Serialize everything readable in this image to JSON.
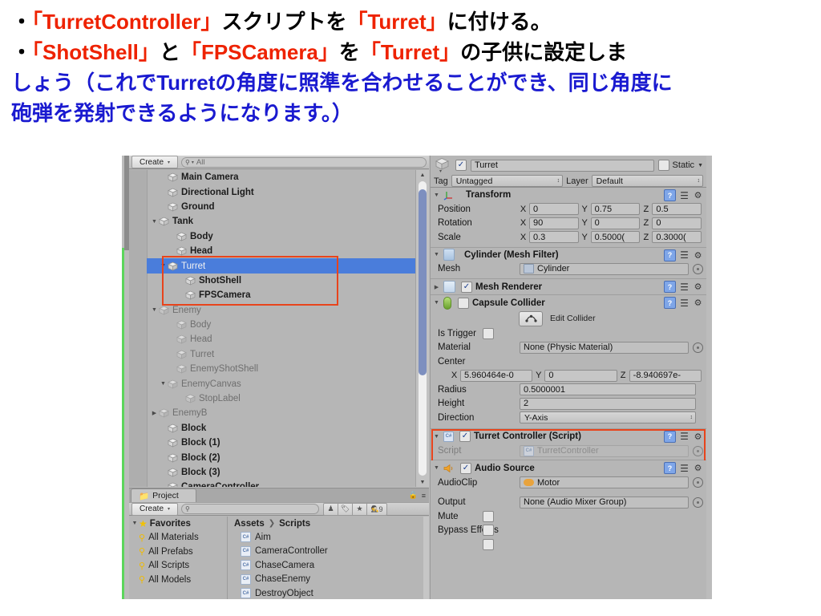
{
  "slide": {
    "line1": [
      {
        "t": "・",
        "c": "blk"
      },
      {
        "t": "「TurretController」",
        "c": "red"
      },
      {
        "t": "スクリプトを",
        "c": "blk"
      },
      {
        "t": "「Turret」",
        "c": "red"
      },
      {
        "t": "に付ける。",
        "c": "blk"
      }
    ],
    "line2": [
      {
        "t": "・",
        "c": "blk"
      },
      {
        "t": "「ShotShell」",
        "c": "red"
      },
      {
        "t": "と",
        "c": "blk"
      },
      {
        "t": "「FPSCamera」",
        "c": "red"
      },
      {
        "t": "を",
        "c": "blk"
      },
      {
        "t": "「Turret」",
        "c": "red"
      },
      {
        "t": "の子供に設定しま",
        "c": "blk"
      }
    ],
    "line3": [
      {
        "t": "しょう（これでTurretの角度に照準を合わせることができ、同じ角度に",
        "c": "blue"
      }
    ],
    "line4": [
      {
        "t": "砲弾を発射できるようになります。）",
        "c": "blue"
      }
    ]
  },
  "colors": {
    "accent_red": "#ee2200",
    "accent_blue": "#1a1ad0",
    "highlight_box": "#e8441c",
    "selection_blue": "#4a7ddb",
    "panel_gray": "#b6b6b6",
    "green_edge": "#5cd65c"
  },
  "hierarchy": {
    "create_label": "Create",
    "create_arrow": "▾",
    "search_placeholder": "All",
    "search_icon": "search-icon",
    "nodes": [
      {
        "label": "Main Camera",
        "indent": 1,
        "fold": "",
        "style": "bold",
        "selected": false
      },
      {
        "label": "Directional Light",
        "indent": 1,
        "fold": "",
        "style": "bold",
        "selected": false
      },
      {
        "label": "Ground",
        "indent": 1,
        "fold": "",
        "style": "bold",
        "selected": false
      },
      {
        "label": "Tank",
        "indent": 0,
        "fold": "▼",
        "style": "bold",
        "selected": false
      },
      {
        "label": "Body",
        "indent": 2,
        "fold": "",
        "style": "bold",
        "selected": false
      },
      {
        "label": "Head",
        "indent": 2,
        "fold": "",
        "style": "bold",
        "selected": false
      },
      {
        "label": "Turret",
        "indent": 1,
        "fold": "▼",
        "style": "sel",
        "selected": true
      },
      {
        "label": "ShotShell",
        "indent": 3,
        "fold": "",
        "style": "bold",
        "selected": false
      },
      {
        "label": "FPSCamera",
        "indent": 3,
        "fold": "",
        "style": "bold",
        "selected": false
      },
      {
        "label": "Enemy",
        "indent": 0,
        "fold": "▼",
        "style": "dim",
        "selected": false
      },
      {
        "label": "Body",
        "indent": 2,
        "fold": "",
        "style": "dim",
        "selected": false
      },
      {
        "label": "Head",
        "indent": 2,
        "fold": "",
        "style": "dim",
        "selected": false
      },
      {
        "label": "Turret",
        "indent": 2,
        "fold": "",
        "style": "dim",
        "selected": false
      },
      {
        "label": "EnemyShotShell",
        "indent": 2,
        "fold": "",
        "style": "dim",
        "selected": false
      },
      {
        "label": "EnemyCanvas",
        "indent": 1,
        "fold": "▼",
        "style": "dim",
        "selected": false
      },
      {
        "label": "StopLabel",
        "indent": 3,
        "fold": "",
        "style": "dim",
        "selected": false
      },
      {
        "label": "EnemyB",
        "indent": 0,
        "fold": "▶",
        "style": "dim",
        "selected": false
      },
      {
        "label": "Block",
        "indent": 1,
        "fold": "",
        "style": "bold",
        "selected": false
      },
      {
        "label": "Block (1)",
        "indent": 1,
        "fold": "",
        "style": "bold",
        "selected": false
      },
      {
        "label": "Block (2)",
        "indent": 1,
        "fold": "",
        "style": "bold",
        "selected": false
      },
      {
        "label": "Block (3)",
        "indent": 1,
        "fold": "",
        "style": "bold",
        "selected": false
      },
      {
        "label": "CameraController",
        "indent": 1,
        "fold": "",
        "style": "bold",
        "selected": false
      }
    ]
  },
  "project": {
    "tab_label": "Project",
    "tab_icon": "folder-icon",
    "lock_icon": "lock-icon",
    "menu_icon": "hamburger-menu-icon",
    "create_label": "Create",
    "create_arrow": "▾",
    "search_placeholder": "",
    "toolbar_icons": [
      "person-filter-icon",
      "label-filter-icon",
      "star-filter-icon",
      "hidden-count-icon"
    ],
    "hidden_count": "9",
    "favorites_label": "Favorites",
    "favorites": [
      "All Materials",
      "All Prefabs",
      "All Scripts",
      "All Models"
    ],
    "breadcrumb": [
      "Assets",
      "Scripts"
    ],
    "breadcrumb_sep": "❯",
    "assets": [
      "Aim",
      "CameraController",
      "ChaseCamera",
      "ChaseEnemy",
      "DestroyObject"
    ]
  },
  "inspector": {
    "object_name": "Turret",
    "object_enabled": true,
    "static_label": "Static",
    "tag_label": "Tag",
    "tag_value": "Untagged",
    "layer_label": "Layer",
    "layer_value": "Default",
    "components": [
      {
        "name": "transform-component",
        "title": "Transform",
        "icon": "transform-axis-icon",
        "fold": "▼",
        "rows": [
          {
            "label": "Position",
            "x": "0",
            "y": "0.75",
            "z": "0.5"
          },
          {
            "label": "Rotation",
            "x": "90",
            "y": "0",
            "z": "0"
          },
          {
            "label": "Scale",
            "x": "0.3",
            "y": "0.5000(",
            "z": "0.3000("
          }
        ]
      },
      {
        "name": "mesh-filter-component",
        "title": "Cylinder (Mesh Filter)",
        "icon": "mesh-filter-icon",
        "fold": "▼",
        "mesh_label": "Mesh",
        "mesh_value": "Cylinder"
      },
      {
        "name": "mesh-renderer-component",
        "title": "Mesh Renderer",
        "icon": "mesh-renderer-icon",
        "fold": "▶",
        "enabled": true
      },
      {
        "name": "capsule-collider-component",
        "title": "Capsule Collider",
        "icon": "capsule-collider-icon",
        "fold": "▼",
        "enabled": false,
        "edit_collider_label": "Edit Collider",
        "is_trigger_label": "Is Trigger",
        "is_trigger": false,
        "material_label": "Material",
        "material_value": "None (Physic Material)",
        "center_label": "Center",
        "center_x": "5.960464e-0",
        "center_y": "0",
        "center_z": "-8.940697e-",
        "radius_label": "Radius",
        "radius_value": "0.5000001",
        "height_label": "Height",
        "height_value": "2",
        "direction_label": "Direction",
        "direction_value": "Y-Axis"
      },
      {
        "name": "turret-controller-script-component",
        "title": "Turret Controller (Script)",
        "icon": "csharp-script-icon",
        "fold": "▼",
        "enabled": true,
        "script_label": "Script",
        "script_value": "TurretController",
        "highlighted": true
      },
      {
        "name": "audio-source-component",
        "title": "Audio Source",
        "icon": "speaker-icon",
        "fold": "▼",
        "enabled": true,
        "audioclip_label": "AudioClip",
        "audioclip_value": "Motor",
        "output_label": "Output",
        "output_value": "None (Audio Mixer Group)",
        "mute_label": "Mute",
        "mute": false,
        "bypass_label": "Bypass Effects",
        "bypass": false
      }
    ]
  }
}
